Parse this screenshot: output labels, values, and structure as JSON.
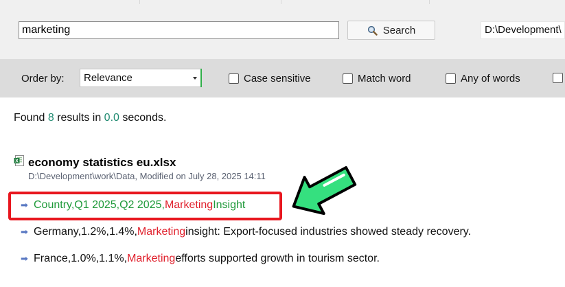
{
  "search": {
    "query": "marketing",
    "button_label": "Search",
    "path": "D:\\Development\\"
  },
  "options": {
    "order_label": "Order by:",
    "order_value": "Relevance",
    "checkboxes": [
      "Case sensitive",
      "Match word",
      "Any of words"
    ]
  },
  "summary": {
    "prefix": "Found",
    "count": "8",
    "middle": "results in",
    "time": "0.0",
    "suffix": "seconds."
  },
  "result": {
    "file_name": "economy statistics eu.xlsx",
    "file_meta": "D:\\Development\\work\\Data, Modified on July 28, 2025 14:11",
    "lines": [
      {
        "before": "Country,Q1 2025,Q2 2025,",
        "match": "Marketing",
        "after": " Insight"
      },
      {
        "before": "Germany,1.2%,1.4%,",
        "match": "Marketing",
        "after": " insight: Export-focused industries showed steady recovery."
      },
      {
        "before": "France,1.0%,1.1%,",
        "match": "Marketing",
        "after": " efforts supported growth in tourism sector."
      }
    ]
  },
  "colors": {
    "highlight": "#e01f2b",
    "annotation_box": "#e8161e",
    "annotation_arrow": "#35e07f",
    "count": "#1f8a70"
  },
  "icons": {
    "search": "magnifier-icon",
    "file": "excel-file-icon",
    "line": "right-arrow-icon"
  }
}
